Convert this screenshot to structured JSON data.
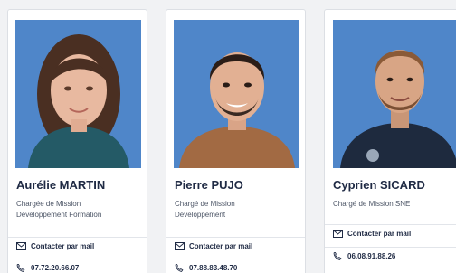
{
  "contacts": [
    {
      "name": "Aurélie MARTIN",
      "role_lines": [
        "Chargée de Mission",
        "Développement Formation"
      ],
      "email_label": "Contacter par mail",
      "phone": "07.72.20.66.07"
    },
    {
      "name": "Pierre PUJO",
      "role_lines": [
        "Chargé de Mission",
        "Développement"
      ],
      "email_label": "Contacter par mail",
      "phone": "07.88.83.48.70"
    },
    {
      "name": "Cyprien SICARD",
      "role_lines": [
        "Chargé de Mission SNE"
      ],
      "email_label": "Contacter par mail",
      "phone": "06.08.91.88.26"
    }
  ],
  "colors": {
    "photo_background": "#4f86c9",
    "name_text": "#1f2a44",
    "role_text": "#4c5566"
  },
  "icons": {
    "email": "envelope-icon",
    "phone": "phone-icon"
  }
}
